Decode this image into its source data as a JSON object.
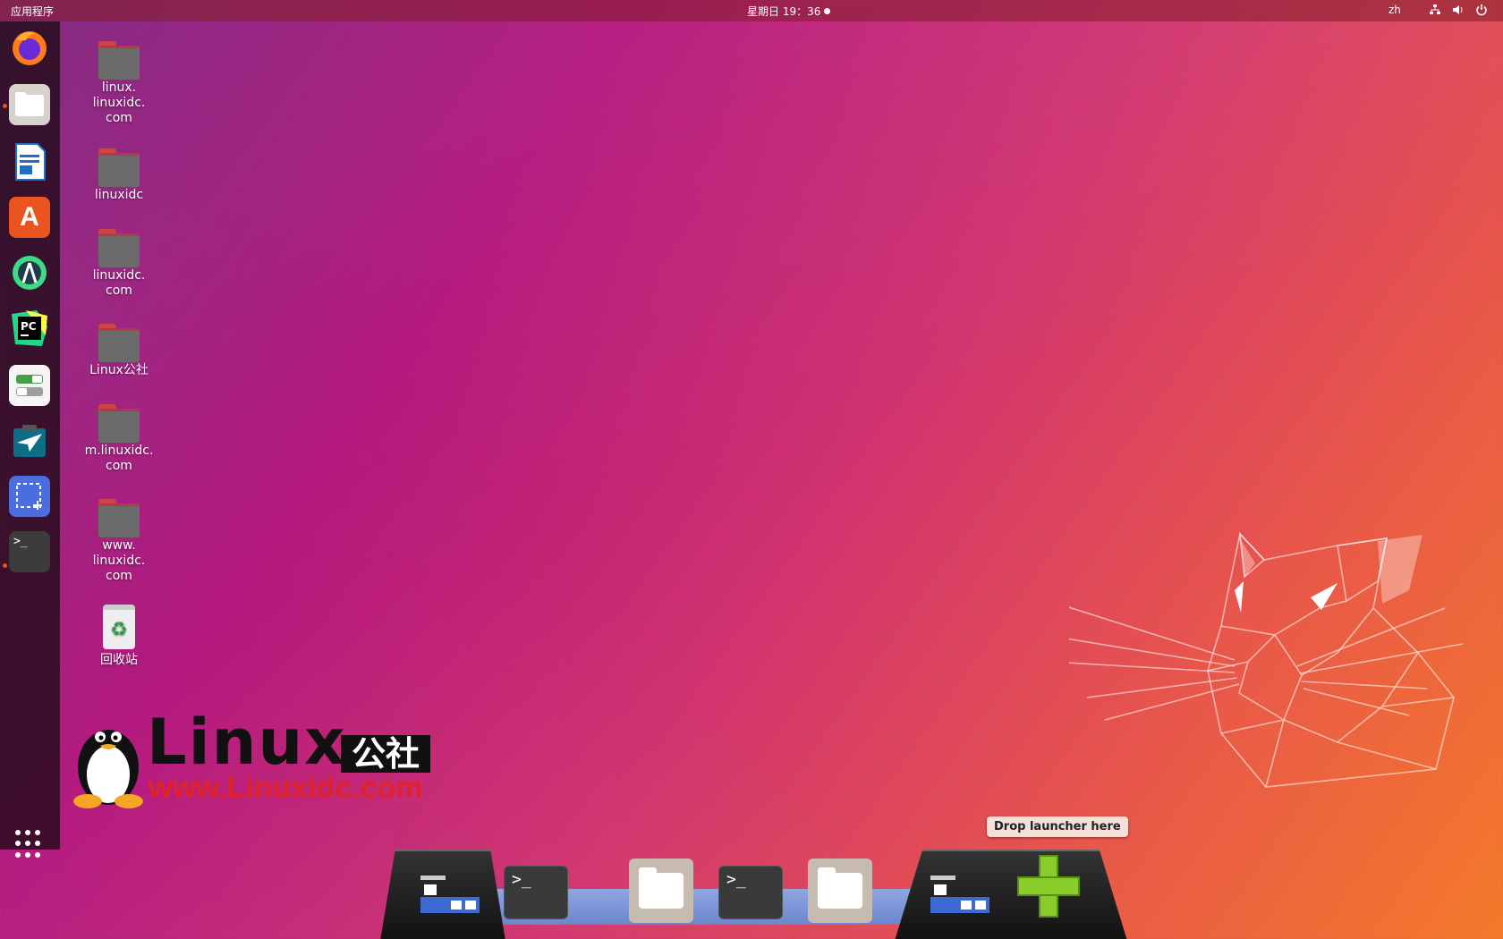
{
  "topbar": {
    "activities": "应用程序",
    "clock": "星期日 19：36",
    "lang": "zh"
  },
  "dock_apps": [
    {
      "name": "firefox"
    },
    {
      "name": "files",
      "running": true
    },
    {
      "name": "libreoffice-writer"
    },
    {
      "name": "ubuntu-software"
    },
    {
      "name": "android-studio"
    },
    {
      "name": "pycharm"
    },
    {
      "name": "settings-toggle"
    },
    {
      "name": "sublime"
    },
    {
      "name": "screenshot"
    },
    {
      "name": "terminal",
      "running": true
    }
  ],
  "desktop": {
    "icons": [
      {
        "label": "linux.\nlinuxidc.\ncom"
      },
      {
        "label": "linuxidc"
      },
      {
        "label": "linuxidc.\ncom"
      },
      {
        "label": "Linux公社"
      },
      {
        "label": "m.linuxidc.\ncom"
      },
      {
        "label": "www.\nlinuxidc.\ncom"
      },
      {
        "label": "回收站"
      }
    ]
  },
  "brand": {
    "title": "Linux",
    "cn": "公社",
    "url": "www.Linuxidc.com"
  },
  "bottom_dock": {
    "tooltip": "Drop launcher here",
    "term_prompt": ">_"
  },
  "colors": {
    "accent": "#e95420"
  }
}
